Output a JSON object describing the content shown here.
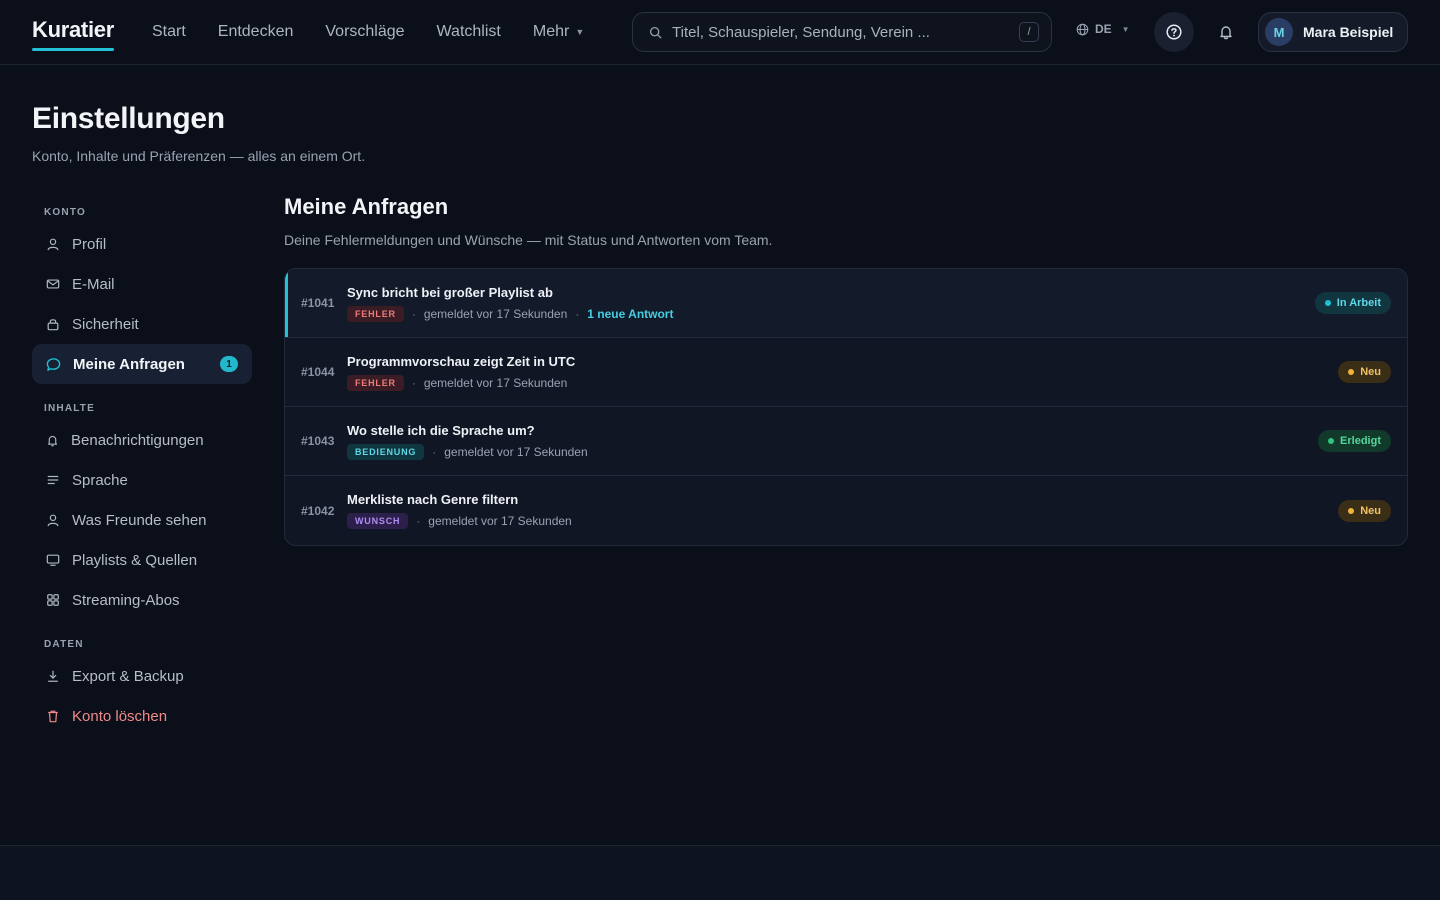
{
  "app": {
    "logo": "Kuratier",
    "accent": "#22c1d6"
  },
  "nav": {
    "items": [
      {
        "label": "Start"
      },
      {
        "label": "Entdecken"
      },
      {
        "label": "Vorschläge"
      },
      {
        "label": "Watchlist"
      },
      {
        "label": "Mehr"
      }
    ]
  },
  "search": {
    "placeholder": "Titel, Schauspieler, Sendung, Verein ...",
    "shortcut": "/"
  },
  "language": {
    "code": "DE"
  },
  "user": {
    "initial": "M",
    "name": "Mara Beispiel"
  },
  "page": {
    "title": "Einstellungen",
    "subtitle": "Konto, Inhalte und Präferenzen — alles an einem Ort."
  },
  "sidebar": {
    "sections": [
      {
        "label": "KONTO"
      },
      {
        "label": "INHALTE"
      },
      {
        "label": "DATEN"
      }
    ],
    "items": [
      {
        "label": "Profil"
      },
      {
        "label": "E-Mail"
      },
      {
        "label": "Sicherheit"
      },
      {
        "label": "Meine Anfragen",
        "badge": "1"
      },
      {
        "label": "Benachrichtigungen"
      },
      {
        "label": "Sprache"
      },
      {
        "label": "Was Freunde sehen"
      },
      {
        "label": "Playlists & Quellen"
      },
      {
        "label": "Streaming-Abos"
      },
      {
        "label": "Export & Backup"
      },
      {
        "label": "Konto löschen"
      }
    ]
  },
  "main": {
    "title": "Meine Anfragen",
    "subtitle": "Deine Fehlermeldungen und Wünsche — mit Status und Antworten vom Team.",
    "requests": [
      {
        "id": "#1041",
        "title": "Sync bricht bei großer Playlist ab",
        "tag": "FEHLER",
        "meta": "gemeldet vor 17 Sekunden",
        "reply": "1 neue Antwort",
        "status": "In Arbeit"
      },
      {
        "id": "#1044",
        "title": "Programmvorschau zeigt Zeit in UTC",
        "tag": "FEHLER",
        "meta": "gemeldet vor 17 Sekunden",
        "status": "Neu"
      },
      {
        "id": "#1043",
        "title": "Wo stelle ich die Sprache um?",
        "tag": "BEDIENUNG",
        "meta": "gemeldet vor 17 Sekunden",
        "status": "Erledigt"
      },
      {
        "id": "#1042",
        "title": "Merkliste nach Genre filtern",
        "tag": "WUNSCH",
        "meta": "gemeldet vor 17 Sekunden",
        "status": "Neu"
      }
    ]
  }
}
